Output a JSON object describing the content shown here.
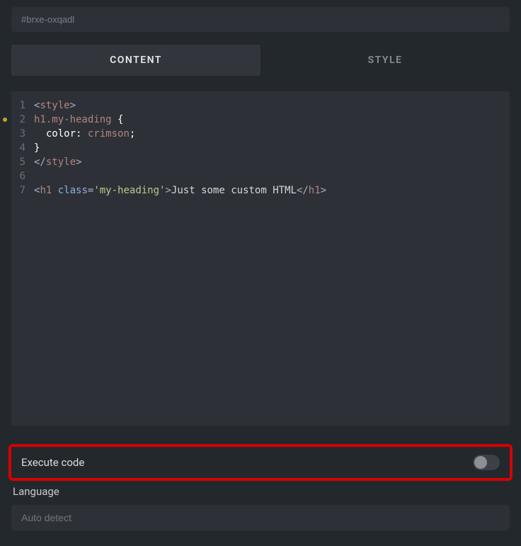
{
  "selector": "#brxe-oxqadl",
  "tabs": {
    "content": "CONTENT",
    "style": "STYLE"
  },
  "code_lines": [
    "1",
    "2",
    "3",
    "4",
    "5",
    "6",
    "7"
  ],
  "tokens": {
    "lt": "<",
    "gt": ">",
    "lt_slash": "</",
    "style": "style",
    "h1": "h1",
    "h1_selector": "h1",
    "my_heading_class": ".my-heading",
    "space": " ",
    "open_brace": "{",
    "close_brace": "}",
    "indent": "  ",
    "color_prop": "color",
    "colon_space": ": ",
    "crimson": "crimson",
    "semicolon": ";",
    "class_attr": "class",
    "eq": "=",
    "my_heading_val": "'my-heading'",
    "content_text": "Just some custom HTML"
  },
  "execute_label": "Execute code",
  "language_label": "Language",
  "language_placeholder": "Auto detect"
}
